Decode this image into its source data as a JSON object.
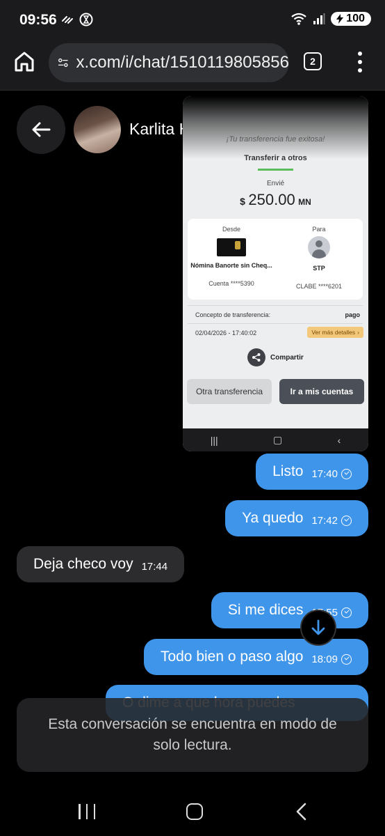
{
  "status_bar": {
    "time": "09:56",
    "battery": "100"
  },
  "browser": {
    "url": "x.com/i/chat/1510119805856",
    "tab_count": "2"
  },
  "chat_header": {
    "contact_name": "Karlita Hdz"
  },
  "shared_screenshot": {
    "success_title": "¡Tu transferencia fue exitosa!",
    "subtitle": "Transferir a otros",
    "sent_label": "Envié",
    "currency_symbol": "$",
    "amount": "250.00",
    "currency": "MN",
    "from_label": "Desde",
    "to_label": "Para",
    "from_account_name": "Nómina Banorte sin Cheq...",
    "to_account_name": "STP",
    "from_account_number": "Cuenta ****5390",
    "to_account_number": "CLABE ****6201",
    "concept_label": "Concepto de transferencia:",
    "concept_value": "pago",
    "datetime": "02/04/2026 - 17:40:02",
    "details_button": "Ver más detalles",
    "share_label": "Compartir",
    "other_transfer_button": "Otra transferencia",
    "my_accounts_button": "Ir a mis cuentas"
  },
  "messages": [
    {
      "text": "Listo",
      "time": "17:40",
      "direction": "sent"
    },
    {
      "text": "Ya quedo",
      "time": "17:42",
      "direction": "sent"
    },
    {
      "text": "Deja checo voy",
      "time": "17:44",
      "direction": "received"
    },
    {
      "text": "Si me dices",
      "time": "17:55",
      "direction": "sent"
    },
    {
      "text": "Todo bien o paso algo",
      "time": "18:09",
      "direction": "sent"
    },
    {
      "text": "O dime a que hora puedes",
      "time": "",
      "direction": "sent"
    }
  ],
  "readonly_notice": "Esta conversación se encuentra en modo de solo lectura.",
  "colors": {
    "sent_bubble": "#3f95ea",
    "received_bubble": "#2c2c2e",
    "background": "#000000"
  }
}
